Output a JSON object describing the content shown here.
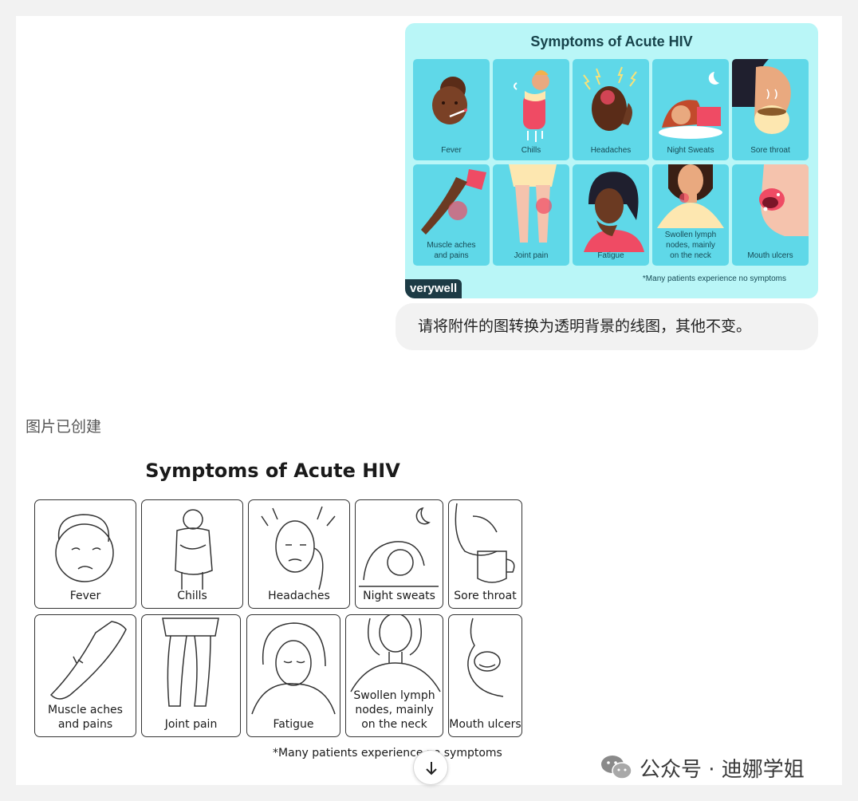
{
  "infographic": {
    "title": "Symptoms of Acute HIV",
    "items": [
      {
        "label": "Fever"
      },
      {
        "label": "Chills"
      },
      {
        "label": "Headaches"
      },
      {
        "label": "Night Sweats"
      },
      {
        "label": "Sore throat"
      },
      {
        "label": "Muscle aches\nand pains"
      },
      {
        "label": "Joint pain"
      },
      {
        "label": "Fatigue"
      },
      {
        "label": "Swollen lymph\nnodes, mainly\non the neck"
      },
      {
        "label": "Mouth ulcers"
      }
    ],
    "footnote": "*Many patients experience no symptoms",
    "logo": "verywell"
  },
  "prompt": {
    "text": "请将附件的图转换为透明背景的线图，其他不变。"
  },
  "status": {
    "text": "图片已创建"
  },
  "lineart": {
    "title": "Symptoms of Acute HIV",
    "items": [
      {
        "label": "Fever"
      },
      {
        "label": "Chills"
      },
      {
        "label": "Headaches"
      },
      {
        "label": "Night sweats"
      },
      {
        "label": "Sore throat"
      },
      {
        "label": "Muscle aches\nand pains"
      },
      {
        "label": "Joint pain"
      },
      {
        "label": "Fatigue"
      },
      {
        "label": "Swollen lymph\nnodes, mainly\non the neck"
      },
      {
        "label": "Mouth ulcers"
      }
    ],
    "footnote": "*Many patients experience no symptoms"
  },
  "watermark": {
    "text": "公众号 · 迪娜学姐",
    "icon": "wechat-icon"
  },
  "colors": {
    "infographic_bg": "#b9f6f7",
    "cell_bg": "#5fd8e8",
    "accent_red": "#ef4b64",
    "skin_dark": "#6b3a22"
  }
}
